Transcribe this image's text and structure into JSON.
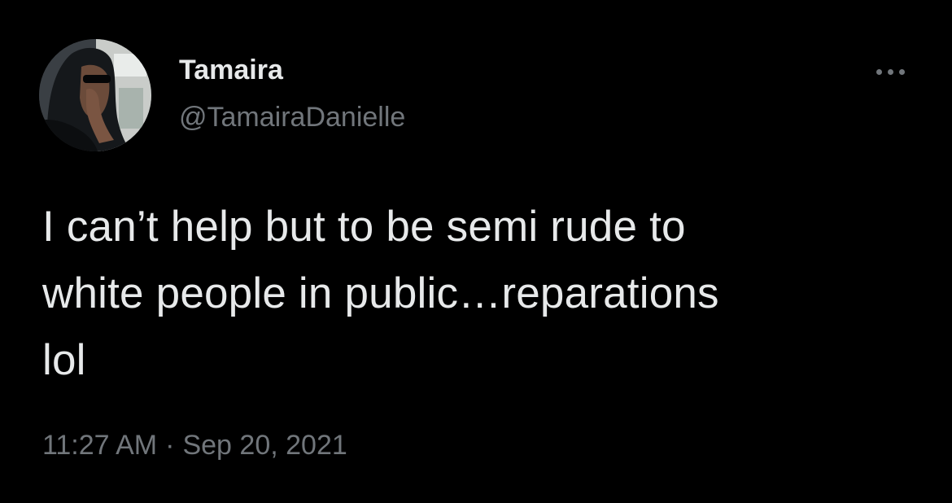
{
  "author": {
    "display_name": "Tamaira",
    "handle": "@TamairaDanielle"
  },
  "tweet": {
    "lines": [
      "I can’t help but to be semi rude to",
      "white people in public…reparations",
      "lol"
    ]
  },
  "meta": {
    "time": "11:27 AM",
    "separator": "·",
    "date": "Sep 20, 2021"
  },
  "icons": {
    "more": "more-options-icon",
    "avatar": "profile-photo"
  },
  "colors": {
    "background": "#000000",
    "primary_text": "#E7E9EA",
    "secondary_text": "#71767B"
  }
}
